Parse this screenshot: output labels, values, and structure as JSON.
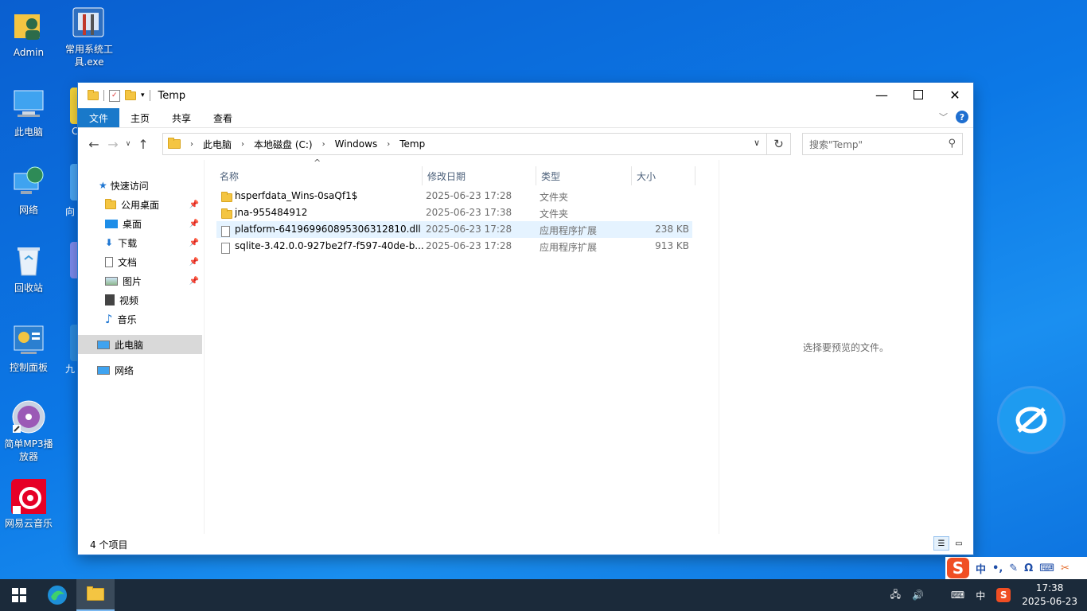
{
  "desktop": {
    "icons": [
      {
        "label": "Admin"
      },
      {
        "label": "常用系统工具.exe"
      },
      {
        "label": "此电脑"
      },
      {
        "label": "网络"
      },
      {
        "label": "回收站"
      },
      {
        "label": "控制面板"
      },
      {
        "label": "简单MP3播放器"
      },
      {
        "label": "网易云音乐"
      }
    ],
    "partial_labels": [
      "C",
      "向",
      "九"
    ]
  },
  "window": {
    "title": "Temp",
    "ribbon_tabs": [
      "文件",
      "主页",
      "共享",
      "查看"
    ],
    "breadcrumb": [
      "此电脑",
      "本地磁盘 (C:)",
      "Windows",
      "Temp"
    ],
    "search_placeholder": "搜索\"Temp\"",
    "nav": {
      "quick_access": "快速访问",
      "items": [
        "公用桌面",
        "桌面",
        "下载",
        "文档",
        "图片",
        "视频",
        "音乐"
      ],
      "this_pc": "此电脑",
      "network": "网络"
    },
    "columns": {
      "name": "名称",
      "date": "修改日期",
      "type": "类型",
      "size": "大小"
    },
    "files": [
      {
        "name": "hsperfdata_Wins-0saQf1$",
        "date": "2025-06-23 17:28",
        "type": "文件夹",
        "size": ""
      },
      {
        "name": "jna-955484912",
        "date": "2025-06-23 17:38",
        "type": "文件夹",
        "size": ""
      },
      {
        "name": "platform-641969960895306312810.dll",
        "date": "2025-06-23 17:28",
        "type": "应用程序扩展",
        "size": "238 KB"
      },
      {
        "name": "sqlite-3.42.0.0-927be2f7-f597-40de-b...",
        "date": "2025-06-23 17:28",
        "type": "应用程序扩展",
        "size": "913 KB"
      }
    ],
    "preview_text": "选择要预览的文件。",
    "status_text": "4 个项目"
  },
  "ime": {
    "mode": "中"
  },
  "taskbar": {
    "ime_indicator": "中",
    "time": "17:38",
    "date": "2025-06-23"
  },
  "colors": {
    "accent": "#1979ca",
    "selection": "#e5f3ff",
    "taskbar": "#1b2a3a"
  }
}
